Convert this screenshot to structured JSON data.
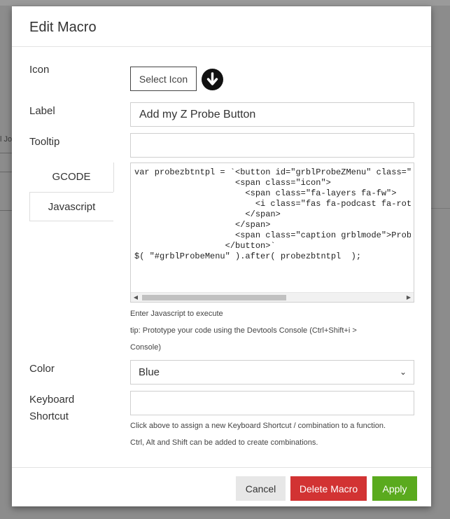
{
  "background": {
    "left_text": "l Jo"
  },
  "modal": {
    "title": "Edit Macro",
    "icon_label": "Icon",
    "select_icon_button": "Select Icon",
    "label_label": "Label",
    "label_value": "Add my Z Probe Button",
    "tooltip_label": "Tooltip",
    "tooltip_value": "",
    "tabs": [
      {
        "label": "GCODE",
        "active": false
      },
      {
        "label": "Javascript",
        "active": true
      }
    ],
    "code_lines": [
      "var probezbtntpl = `<button id=\"grblProbeZMenu\" class=\"r",
      "                    <span class=\"icon\">",
      "                      <span class=\"fa-layers fa-fw\">",
      "                        <i class=\"fas fa-podcast fa-rotate",
      "                      </span>",
      "                    </span>",
      "                    <span class=\"caption grblmode\">Probe Z",
      "                  </button>`",
      "$( \"#grblProbeMenu\" ).after( probezbtntpl  );"
    ],
    "help_js_1": "Enter Javascript to execute",
    "help_js_2": "tip: Prototype your code using the Devtools Console (Ctrl+Shift+i >",
    "help_js_3": "Console)",
    "color_label": "Color",
    "color_value": "Blue",
    "shortcut_label_1": "Keyboard",
    "shortcut_label_2": "Shortcut",
    "shortcut_value": "",
    "help_shortcut_1": "Click above to assign a new Keyboard Shortcut / combination to a function.",
    "help_shortcut_2": "Ctrl, Alt and Shift can be added to create combinations.",
    "buttons": {
      "cancel": "Cancel",
      "delete": "Delete Macro",
      "apply": "Apply"
    }
  },
  "colors": {
    "delete": "#d23333",
    "apply": "#5aaa1e",
    "cancel": "#e7e7e7"
  },
  "icons": {
    "download": "arrow-down-circle-icon",
    "select": "chevron-down-icon"
  }
}
